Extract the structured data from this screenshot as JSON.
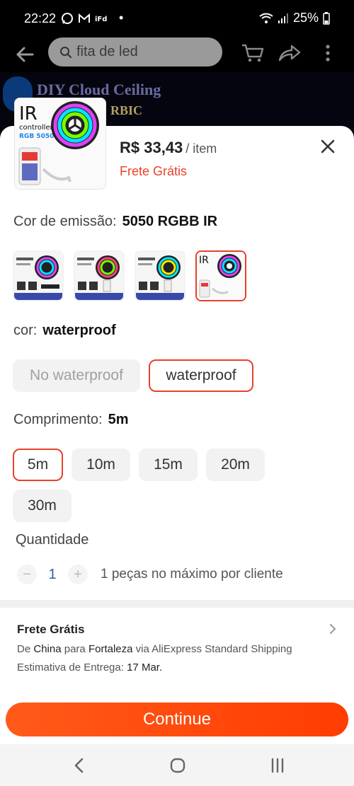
{
  "status": {
    "time": "22:22",
    "app_icons": [
      "whatsapp-icon",
      "gmail-icon",
      "ifood-icon"
    ],
    "dot": "•",
    "battery": "25%"
  },
  "search": {
    "placeholder": "fita de led"
  },
  "background_banner": {
    "title": "DIY Cloud Ceiling",
    "subtitle": "RBIC"
  },
  "product": {
    "thumb_label_ir": "IR",
    "thumb_label_controller": "controller",
    "thumb_label_model": "RGB 5050",
    "price": "R$ 33,43",
    "price_unit": "/ item",
    "shipping": "Frete Grátis"
  },
  "color_emission": {
    "label": "Cor de emissão:",
    "value": "5050 RGBB IR",
    "options": [
      {
        "name": "bluetooth-variant-1",
        "selected": false
      },
      {
        "name": "wifi-variant",
        "selected": false
      },
      {
        "name": "bluetooth-variant-2",
        "selected": false
      },
      {
        "name": "ir-variant",
        "selected": true
      }
    ]
  },
  "cor": {
    "label": "cor:",
    "value": "waterproof",
    "options": [
      "No waterproof",
      "waterproof"
    ]
  },
  "length": {
    "label": "Comprimento:",
    "value": "5m",
    "options": [
      "5m",
      "10m",
      "15m",
      "20m",
      "30m"
    ]
  },
  "quantity": {
    "label": "Quantidade",
    "minus": "−",
    "value": "1",
    "plus": "+",
    "note": "1 peças no máximo por cliente"
  },
  "shipping_info": {
    "title": "Frete Grátis",
    "route_de": "De",
    "route_from": "China",
    "route_para": "para",
    "route_to": "Fortaleza",
    "route_via": "via AliExpress Standard Shipping",
    "eta_label": "Estimativa de Entrega:",
    "eta_value": "17 Mar."
  },
  "cta": {
    "continue": "Continue"
  },
  "colors": {
    "accent": "#e8412a",
    "cta": "#ff4a0a"
  }
}
